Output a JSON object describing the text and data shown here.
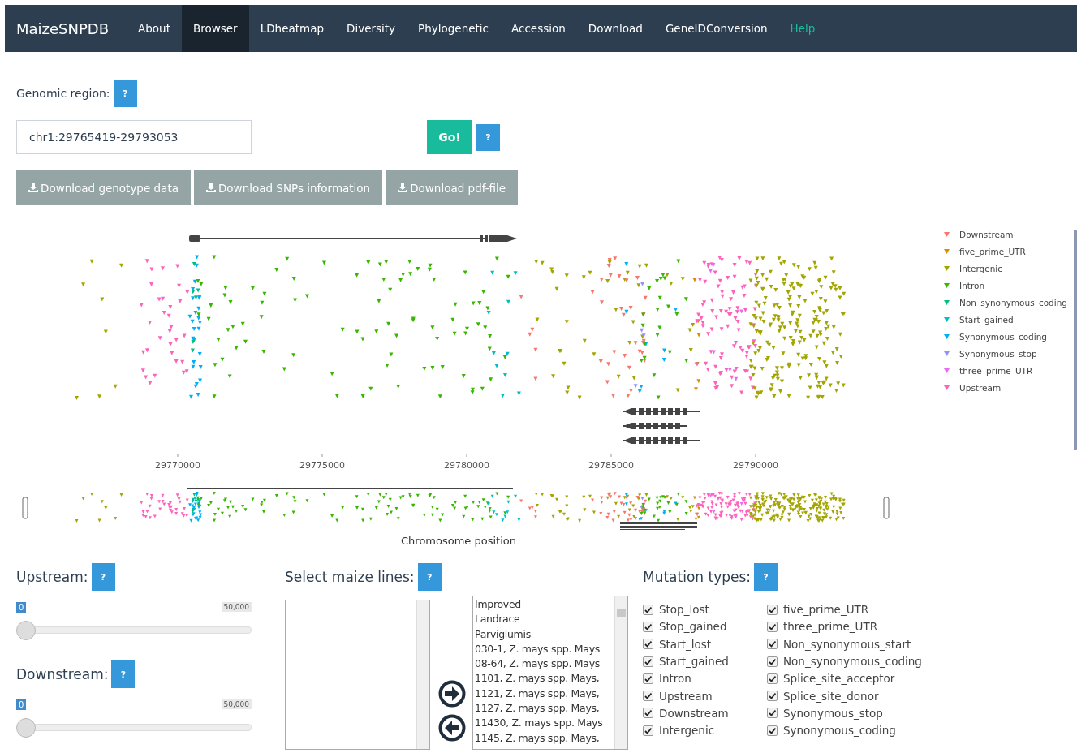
{
  "navbar": {
    "brand": "MaizeSNPDB",
    "items": [
      {
        "label": "About",
        "selected": false,
        "kind": "link"
      },
      {
        "label": "Browser",
        "selected": true,
        "kind": "link"
      },
      {
        "label": "LDheatmap",
        "selected": false,
        "kind": "link"
      },
      {
        "label": "Diversity",
        "selected": false,
        "kind": "link"
      },
      {
        "label": "Phylogenetic",
        "selected": false,
        "kind": "link"
      },
      {
        "label": "Accession",
        "selected": false,
        "kind": "link"
      },
      {
        "label": "Download",
        "selected": false,
        "kind": "link"
      },
      {
        "label": "GeneIDConversion",
        "selected": false,
        "kind": "link"
      },
      {
        "label": "Help",
        "selected": false,
        "kind": "help"
      }
    ]
  },
  "region": {
    "label": "Genomic region:",
    "help": "?",
    "value": "chr1:29765419-29793053",
    "go": "Go!",
    "go_help": "?"
  },
  "downloads": [
    "Download genotype data",
    "Download SNPs information",
    "Download pdf-file"
  ],
  "plot": {
    "x_ticks": [
      "29770000",
      "29775000",
      "29780000",
      "29785000",
      "29790000"
    ],
    "xlabel": "Chromosome position",
    "legend": [
      {
        "label": "Downstream",
        "color": "#f8766d"
      },
      {
        "label": "five_prime_UTR",
        "color": "#d89000"
      },
      {
        "label": "Intergenic",
        "color": "#a3a500"
      },
      {
        "label": "Intron",
        "color": "#39b600"
      },
      {
        "label": "Non_synonymous_coding",
        "color": "#00bf7d"
      },
      {
        "label": "Start_gained",
        "color": "#00bfc4"
      },
      {
        "label": "Synonymous_coding",
        "color": "#00b0f6"
      },
      {
        "label": "Synonymous_stop",
        "color": "#9590ff"
      },
      {
        "label": "three_prime_UTR",
        "color": "#e76bf3"
      },
      {
        "label": "Upstream",
        "color": "#ff62bc"
      }
    ]
  },
  "upstream": {
    "label": "Upstream:",
    "help": "?",
    "value": "0",
    "max": "50,000",
    "level": 0
  },
  "downstream": {
    "label": "Downstream:",
    "help": "?",
    "value": "0",
    "max": "50,000",
    "level": 0
  },
  "lines": {
    "label": "Select maize lines:",
    "help": "?",
    "options": [
      "Improved",
      "Landrace",
      "Parviglumis",
      "030-1, Z. mays spp. Mays",
      "08-64, Z. mays spp. Mays",
      "1101, Z. mays spp. Mays,",
      "1121, Z. mays spp. Mays,",
      "1127, Z. mays spp. Mays,",
      "11430, Z. mays spp. Mays",
      "1145, Z. mays spp. Mays,"
    ]
  },
  "mutations": {
    "label": "Mutation types:",
    "help": "?",
    "items": [
      {
        "label": "Stop_lost",
        "checked": true
      },
      {
        "label": "five_prime_UTR",
        "checked": true
      },
      {
        "label": "Stop_gained",
        "checked": true
      },
      {
        "label": "three_prime_UTR",
        "checked": true
      },
      {
        "label": "Start_lost",
        "checked": true
      },
      {
        "label": "Non_synonymous_start",
        "checked": true
      },
      {
        "label": "Start_gained",
        "checked": true
      },
      {
        "label": "Non_synonymous_coding",
        "checked": true
      },
      {
        "label": "Intron",
        "checked": true
      },
      {
        "label": "Splice_site_acceptor",
        "checked": true
      },
      {
        "label": "Upstream",
        "checked": true
      },
      {
        "label": "Splice_site_donor",
        "checked": true
      },
      {
        "label": "Downstream",
        "checked": true
      },
      {
        "label": "Synonymous_stop",
        "checked": true
      },
      {
        "label": "Intergenic",
        "checked": true
      },
      {
        "label": "Synonymous_coding",
        "checked": true
      }
    ]
  }
}
